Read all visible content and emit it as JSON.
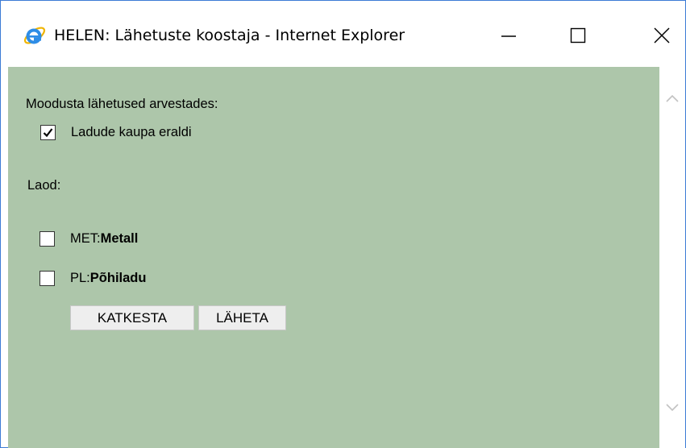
{
  "window": {
    "title": "HELEN: Lähetuste koostaja - Internet Explorer",
    "app_icon": "internet-explorer-icon",
    "controls": {
      "minimize": "minimize-icon",
      "maximize": "maximize-icon",
      "close": "close-icon"
    },
    "accent_color": "#3c7bd6"
  },
  "form": {
    "background_color": "#adc6aa",
    "heading": "Moodusta lähetused arvestades:",
    "option": {
      "label": "Ladude kaupa eraldi",
      "checked": true
    },
    "warehouses_label": "Laod:",
    "warehouses": [
      {
        "code": "MET:",
        "name": "Metall",
        "checked": false
      },
      {
        "code": "PL:",
        "name": "Põhiladu",
        "checked": false
      }
    ],
    "buttons": {
      "cancel": "KATKESTA",
      "send": "LÄHETA"
    }
  }
}
